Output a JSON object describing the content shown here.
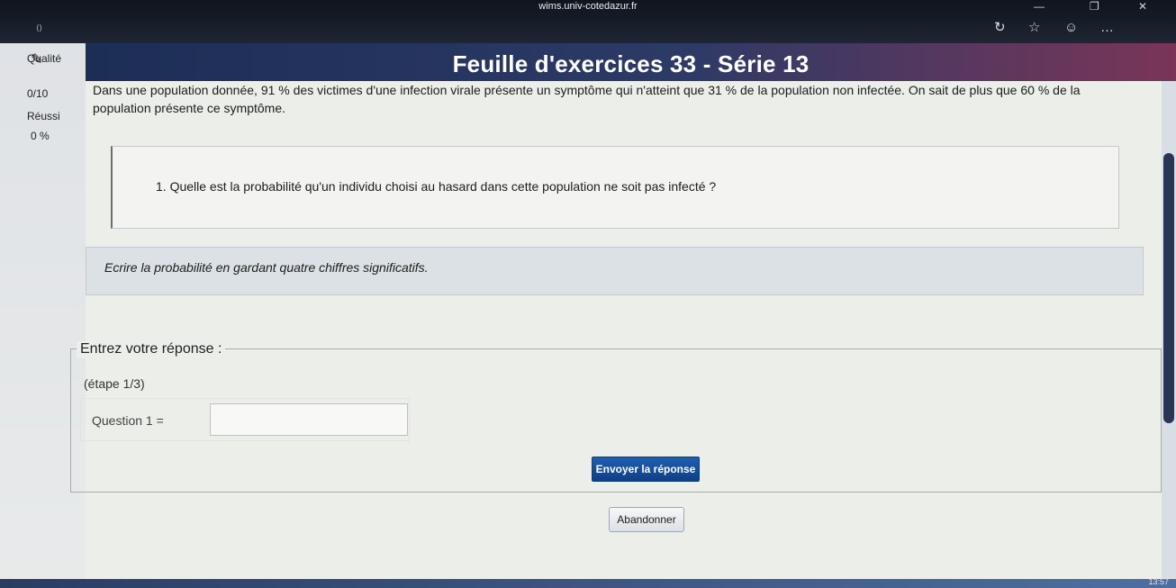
{
  "browser": {
    "url": "wims.univ-cotedazur.fr",
    "minimize_glyph": "—",
    "restore_glyph": "❐",
    "close_glyph": "✕",
    "toolbar_icons": {
      "reload": "↻",
      "favorites": "☆",
      "profile": "☺",
      "more": "…"
    }
  },
  "sidebar": {
    "icon": "wand-icon",
    "quality_label": "Qualité",
    "quality_value": "0/10",
    "success_label": "Réussi",
    "success_value": "0 %"
  },
  "page": {
    "title": "Feuille d'exercices 33 - Série 13",
    "intro": "Dans une population donnée, 91 % des victimes d'une infection virale présente un symptôme qui n'atteint que 31 % de la population non infectée. On sait de plus que 60 % de la population présente ce symptôme.",
    "question": "1. Quelle est la probabilité qu'un individu choisi au hasard dans cette population ne soit pas infecté ?",
    "instruction": "Ecrire la probabilité en gardant quatre chiffres significatifs."
  },
  "answer": {
    "legend": "Entrez votre réponse :",
    "step": "(étape 1/3)",
    "question_label": "Question 1 =",
    "input_value": "",
    "submit_label": "Envoyer la réponse"
  },
  "footer": {
    "abandon_label": "Abandonner"
  },
  "taskbar": {
    "clock": "13:57"
  }
}
